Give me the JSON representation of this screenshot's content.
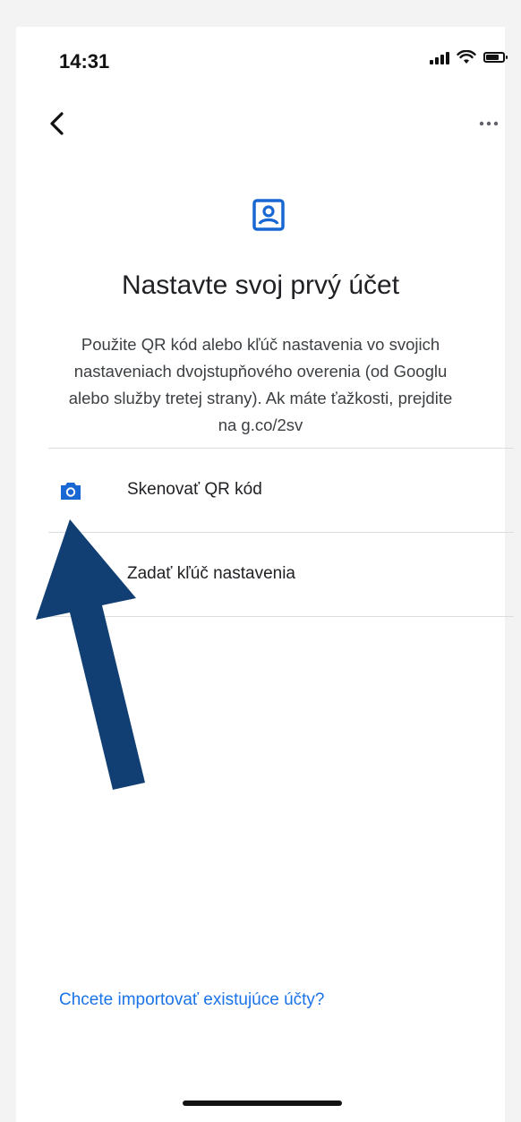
{
  "status_bar": {
    "time": "14:31"
  },
  "nav": {
    "back_icon": "chevron-left-icon",
    "more_icon": "more-horizontal-icon"
  },
  "header": {
    "icon": "account-box-icon",
    "title": "Nastavte svoj prvý účet",
    "description_lines": [
      "Použite QR kód alebo kľúč nastavenia vo svojich",
      "nastaveniach dvojstupňového overenia (od Googlu",
      "alebo služby tretej strany). Ak máte ťažkosti, prejdite",
      "na g.co/2sv"
    ]
  },
  "options": [
    {
      "label": "Skenovať QR kód",
      "icon": "camera-icon"
    },
    {
      "label": "Zadať kľúč nastavenia",
      "icon": "keyboard-icon"
    }
  ],
  "footer": {
    "import_link": "Chcete importovať existujúce účty?"
  },
  "annotation": {
    "arrow_color": "#123f73"
  },
  "colors": {
    "accent": "#1a73e8",
    "icon_blue": "#1967d2",
    "divider": "#dadce0"
  }
}
